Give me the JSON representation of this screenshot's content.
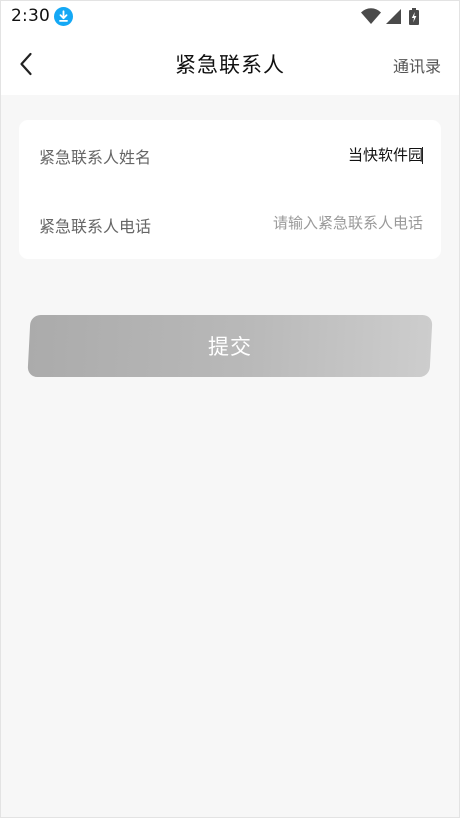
{
  "status_bar": {
    "time": "2:30",
    "icons": [
      "download-icon",
      "wifi-icon",
      "signal-icon",
      "battery-charging-icon"
    ],
    "download_badge_color": "#14a8f5"
  },
  "nav_bar": {
    "back_icon": "chevron-left-icon",
    "title": "紧急联系人",
    "contacts_link": "通讯录"
  },
  "form": {
    "name_label": "紧急联系人姓名",
    "name_value": "当快软件园",
    "phone_label": "紧急联系人电话",
    "phone_value": "",
    "phone_placeholder": "请输入紧急联系人电话"
  },
  "submit": {
    "label": "提交",
    "state": "disabled"
  },
  "colors": {
    "page_background": "#f7f7f7",
    "card_background": "#ffffff",
    "button_gradient_start": "#ababab",
    "button_gradient_end": "#cdcdcd",
    "label_text": "#666666",
    "placeholder_text": "#9a9a9a"
  }
}
